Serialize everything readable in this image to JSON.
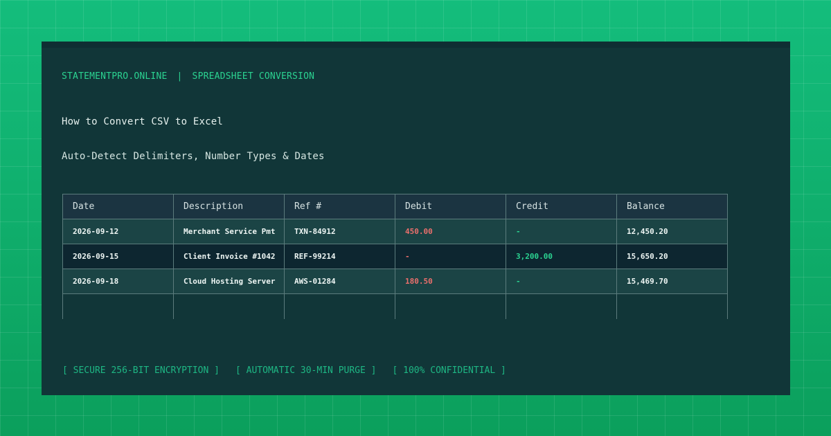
{
  "header": {
    "brand": "STATEMENTPRO.ONLINE",
    "separator": "|",
    "section": "SPREADSHEET CONVERSION"
  },
  "title": "How to Convert CSV to Excel",
  "subtitle": "Auto-Detect Delimiters, Number Types & Dates",
  "table": {
    "columns": [
      "Date",
      "Description",
      "Ref #",
      "Debit",
      "Credit",
      "Balance"
    ],
    "rows": [
      {
        "date": "2026-09-12",
        "description": "Merchant Service Pmt",
        "ref": "TXN-84912",
        "debit": "450.00",
        "credit": "-",
        "balance": "12,450.20"
      },
      {
        "date": "2026-09-15",
        "description": "Client Invoice #1042",
        "ref": "REF-99214",
        "debit": "-",
        "credit": "3,200.00",
        "balance": "15,650.20"
      },
      {
        "date": "2026-09-18",
        "description": "Cloud Hosting Server",
        "ref": "AWS-01284",
        "debit": "180.50",
        "credit": "-",
        "balance": "15,469.70"
      }
    ]
  },
  "footer": {
    "badges": [
      "[ SECURE 256-BIT ENCRYPTION ]",
      "[ AUTOMATIC 30-MIN PURGE ]",
      "[ 100% CONFIDENTIAL ]"
    ]
  },
  "colors": {
    "background": "#0fb06e",
    "panel": "#113638",
    "accent": "#2bd391",
    "debit": "#ea6f6c",
    "credit": "#2bd391"
  }
}
